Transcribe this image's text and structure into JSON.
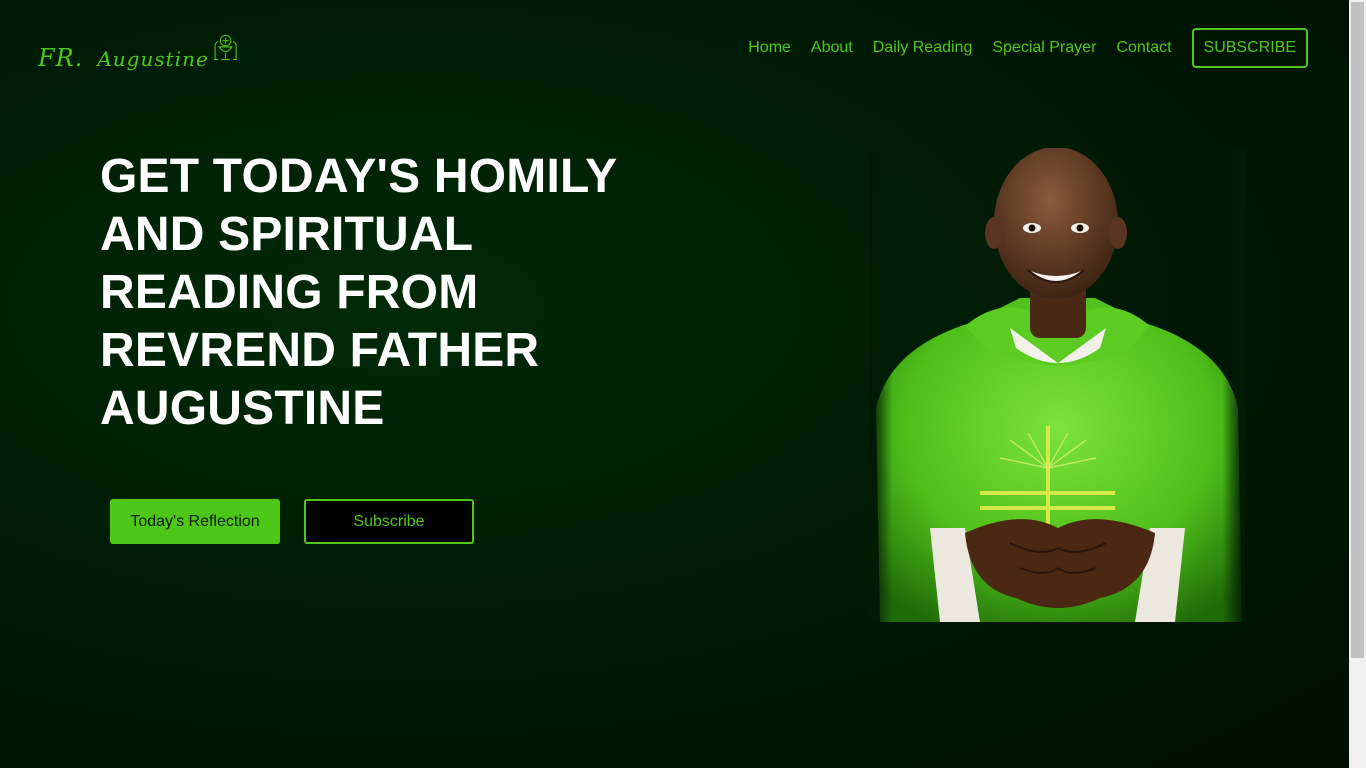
{
  "header": {
    "logo": {
      "text_main": "FR.",
      "text_name": "Augustine"
    },
    "nav": [
      {
        "label": "Home"
      },
      {
        "label": "About"
      },
      {
        "label": "Daily Reading"
      },
      {
        "label": "Special Prayer"
      },
      {
        "label": "Contact"
      }
    ],
    "subscribe_label": "SUBSCRIBE"
  },
  "hero": {
    "title": "GET TODAY'S HOMILY AND SPIRITUAL READING FROM REVREND FATHER AUGUSTINE",
    "primary_button": "Today's Reflection",
    "secondary_button": "Subscribe"
  },
  "colors": {
    "accent": "#4ec818",
    "background": "#001a04",
    "title": "#ffffff"
  },
  "icons": {
    "logo_emblem": "chalice-host-icon"
  }
}
